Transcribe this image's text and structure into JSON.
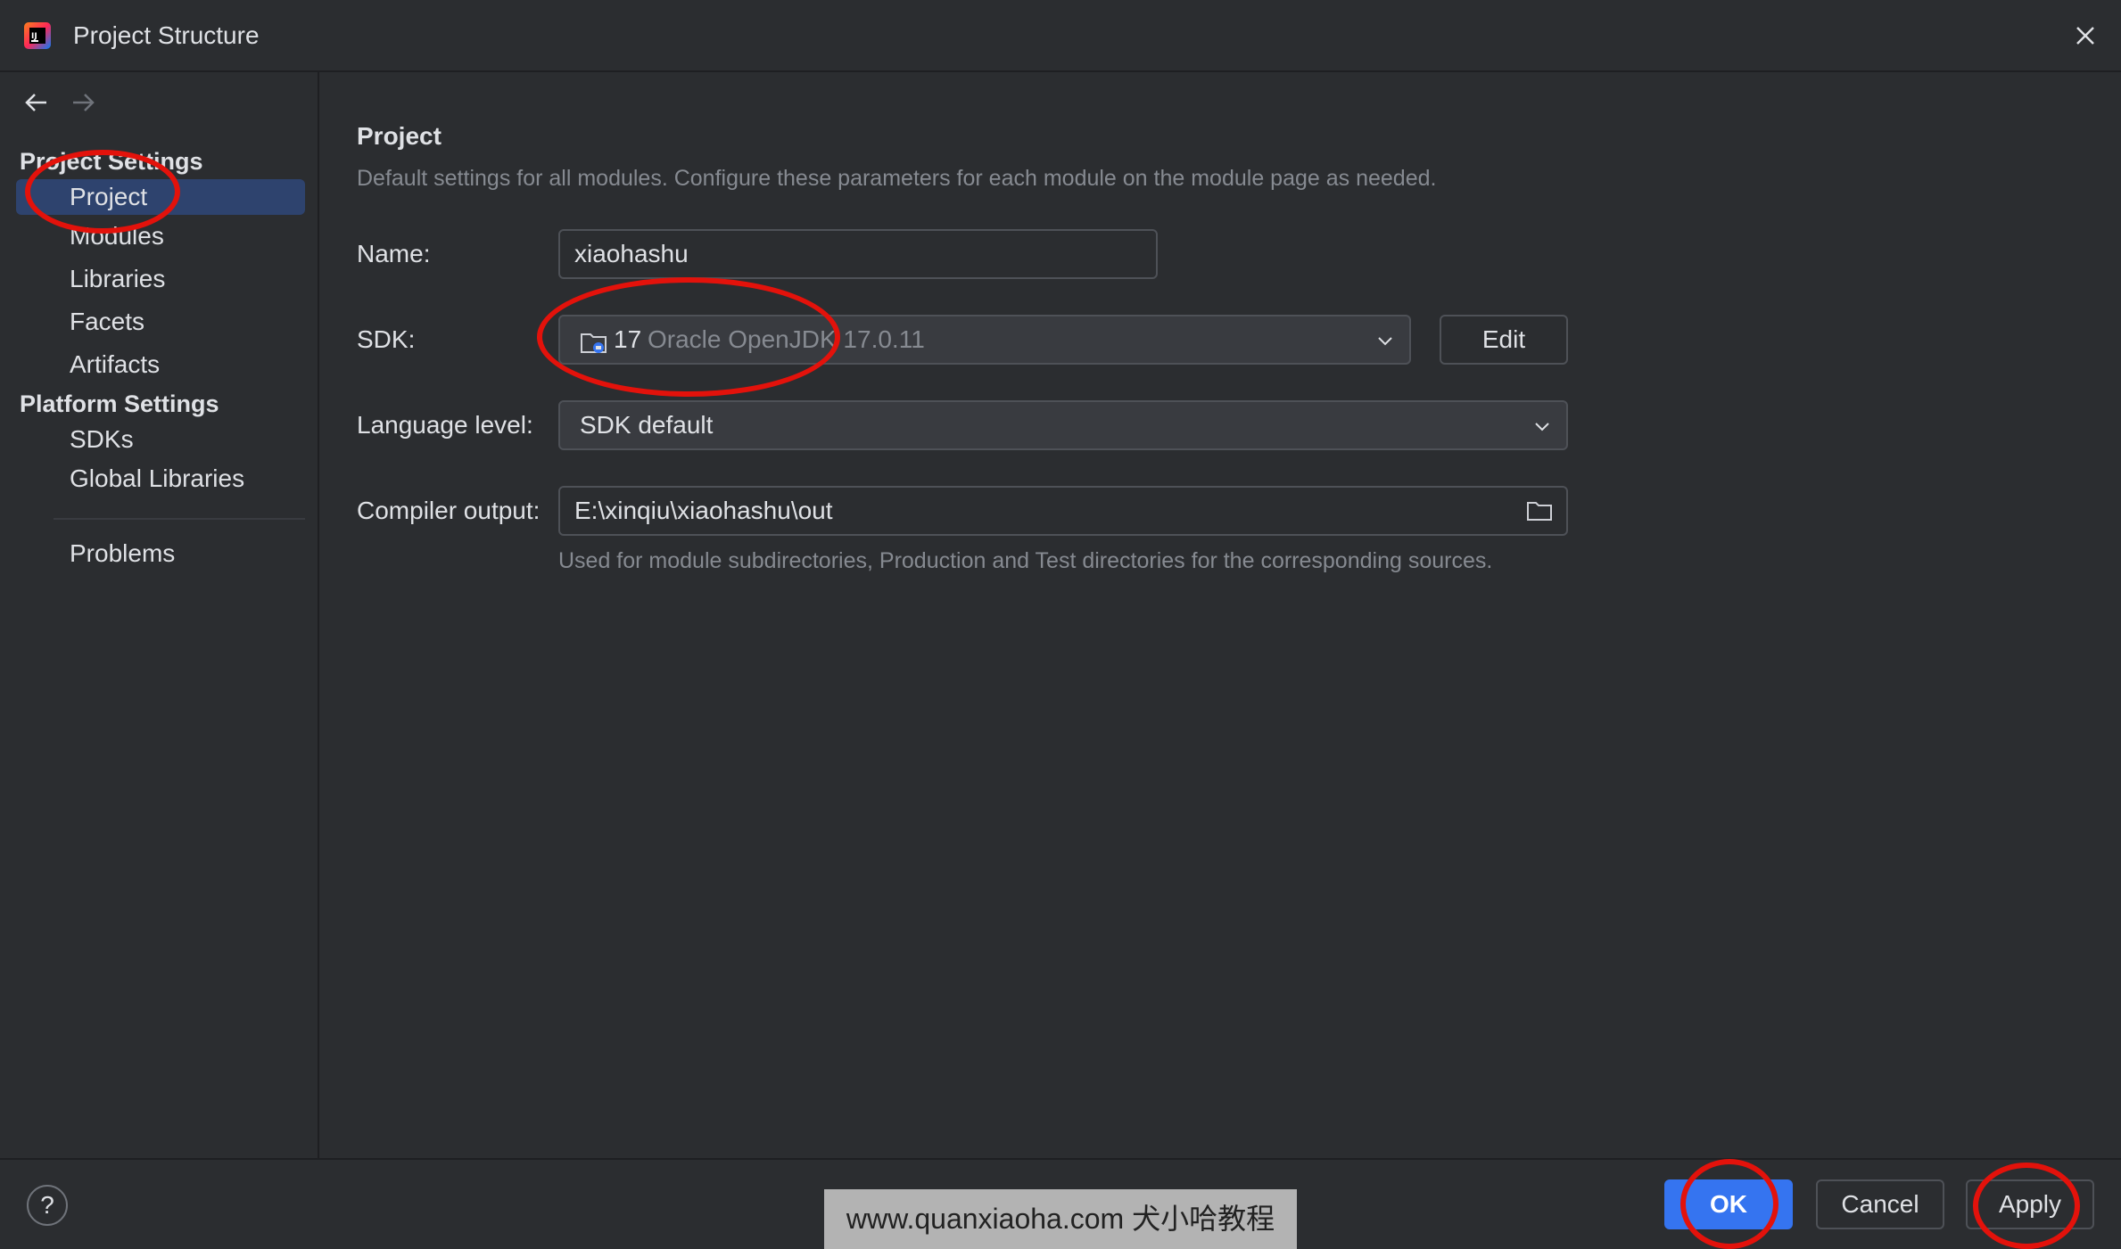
{
  "window": {
    "title": "Project Structure",
    "icon": "intellij-idea-icon",
    "close_icon": "close-icon"
  },
  "sidebar": {
    "nav": {
      "back_icon": "arrow-left-icon",
      "forward_icon": "arrow-right-icon"
    },
    "project_settings": {
      "heading": "Project Settings",
      "items": [
        {
          "label": "Project",
          "selected": true
        },
        {
          "label": "Modules"
        },
        {
          "label": "Libraries"
        },
        {
          "label": "Facets"
        },
        {
          "label": "Artifacts"
        }
      ]
    },
    "platform_settings": {
      "heading": "Platform Settings",
      "items": [
        {
          "label": "SDKs"
        },
        {
          "label": "Global Libraries"
        }
      ]
    },
    "problems": {
      "label": "Problems"
    }
  },
  "main": {
    "title": "Project",
    "description": "Default settings for all modules. Configure these parameters for each module on the module page as needed.",
    "name": {
      "label": "Name:",
      "value": "xiaohashu"
    },
    "sdk": {
      "label": "SDK:",
      "version": "17",
      "detail": "Oracle OpenJDK 17.0.11",
      "edit_label": "Edit",
      "icon": "sdk-folder-icon"
    },
    "language_level": {
      "label": "Language level:",
      "value": "SDK default"
    },
    "compiler_output": {
      "label": "Compiler output:",
      "value": "E:\\xinqiu\\xiaohashu\\out",
      "browse_icon": "folder-icon",
      "hint": "Used for module subdirectories, Production and Test directories for the corresponding sources."
    }
  },
  "footer": {
    "help_label": "?",
    "ok_label": "OK",
    "cancel_label": "Cancel",
    "apply_label": "Apply"
  },
  "watermark": {
    "text": "www.quanxiaoha.com 犬小哈教程"
  },
  "colors": {
    "background": "#2b2d30",
    "selection": "#2e436e",
    "primary_button": "#3574f0",
    "annotation": "#e3120b"
  }
}
